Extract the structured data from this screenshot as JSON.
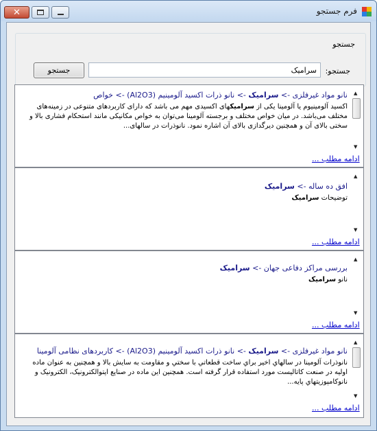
{
  "window": {
    "title": "فرم جستجو",
    "icon_colors": [
      "#e2372b",
      "#f4b400",
      "#2a7de1",
      "#35a853"
    ]
  },
  "search": {
    "group_label": "جستجو",
    "field_label": "جستجو:",
    "value": "سرامیک",
    "button_label": "جستجو"
  },
  "results": [
    {
      "path_before": "نانو مواد غیرفلزی -> ",
      "path_bold": "سرامیک",
      "path_after": " -> نانو ذرات اکسید آلومینیم (Al2O3) -> خواص",
      "desc_before": "اکسید آلومینیوم یا آلومینا یکی از ",
      "desc_bold": "سرامیک",
      "desc_after": "های اکسیدی مهم می باشد که دارای کاربردهای متنوعی در زمینه‌های مختلف می‌باشد. در میان خواص مختلف و برجسته آلومینا می‌توان به خواص مکانیکی مانند استحکام فشاری بالا و سختی بالای آن و همچنین دیرگدازی بالای آن اشاره نمود. نانوذرات در سالهای...",
      "read_more": "ادامه مطلب ..."
    },
    {
      "path_before": "افق ده ساله -> ",
      "path_bold": "سرامیک",
      "path_after": "",
      "desc_before": "توضیحات ",
      "desc_bold": "سرامیک",
      "desc_after": "",
      "read_more": "ادامه مطلب ..."
    },
    {
      "path_before": "بررسی مراکز دفاعی جهان -> ",
      "path_bold": "سرامیک",
      "path_after": "",
      "desc_before": "نانو ",
      "desc_bold": "سرامیک",
      "desc_after": "",
      "read_more": "ادامه مطلب ..."
    },
    {
      "path_before": "نانو مواد غیرفلزی -> ",
      "path_bold": "سرامیک",
      "path_after": " -> نانو ذرات اکسید آلومینیم (Al2O3) -> کاربردهای نظامی آلومینا",
      "desc_before": "نانوذرات آلومینا در سالهاي اخیر براي ساخت قطعاتي با سختي و مقاومت به سايش بالا و همچنين به عنوان ماده اولیه در صنعت کاتالیست مورد استفاده قرار گرفته است. همچنين اين ماده در صنايع اپتوالکترونيک، الکترونيک و نانوکامپوزيتهاي پايه...",
      "desc_bold": "",
      "desc_after": "",
      "read_more": "ادامه مطلب ..."
    }
  ]
}
